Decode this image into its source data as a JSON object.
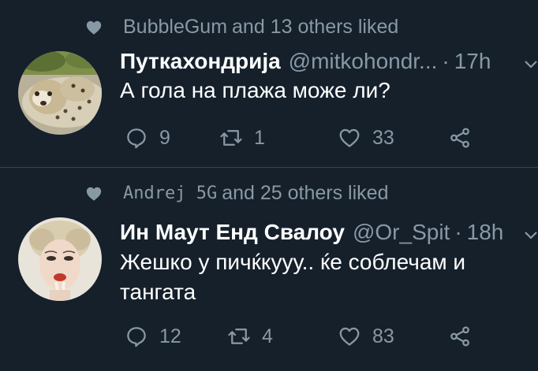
{
  "colors": {
    "background": "#15202b",
    "muted": "#8899a6",
    "divider": "#38444d",
    "text": "#ffffff"
  },
  "tweets": [
    {
      "social_context": {
        "liker": "BubbleGum",
        "rest": "and 13 others liked"
      },
      "display_name": "Путкахондрија",
      "handle": "@mitkohondr...",
      "separator": "·",
      "time": "17h",
      "text": "А гола на плажа може ли?",
      "avatar_icon": "cheetah-cub-avatar",
      "actions": {
        "replies": "9",
        "retweets": "1",
        "likes": "33"
      }
    },
    {
      "social_context": {
        "liker": "Andrej 5G",
        "rest": "and 25 others liked"
      },
      "display_name": "Ин Маут Енд Свалоу",
      "handle": "@Or_Spit",
      "separator": "·",
      "time": "18h",
      "text": "Жешко у пичќкууу.. ќе соблечам и тангата",
      "avatar_icon": "marilyn-portrait-avatar",
      "actions": {
        "replies": "12",
        "retweets": "4",
        "likes": "83"
      }
    }
  ]
}
